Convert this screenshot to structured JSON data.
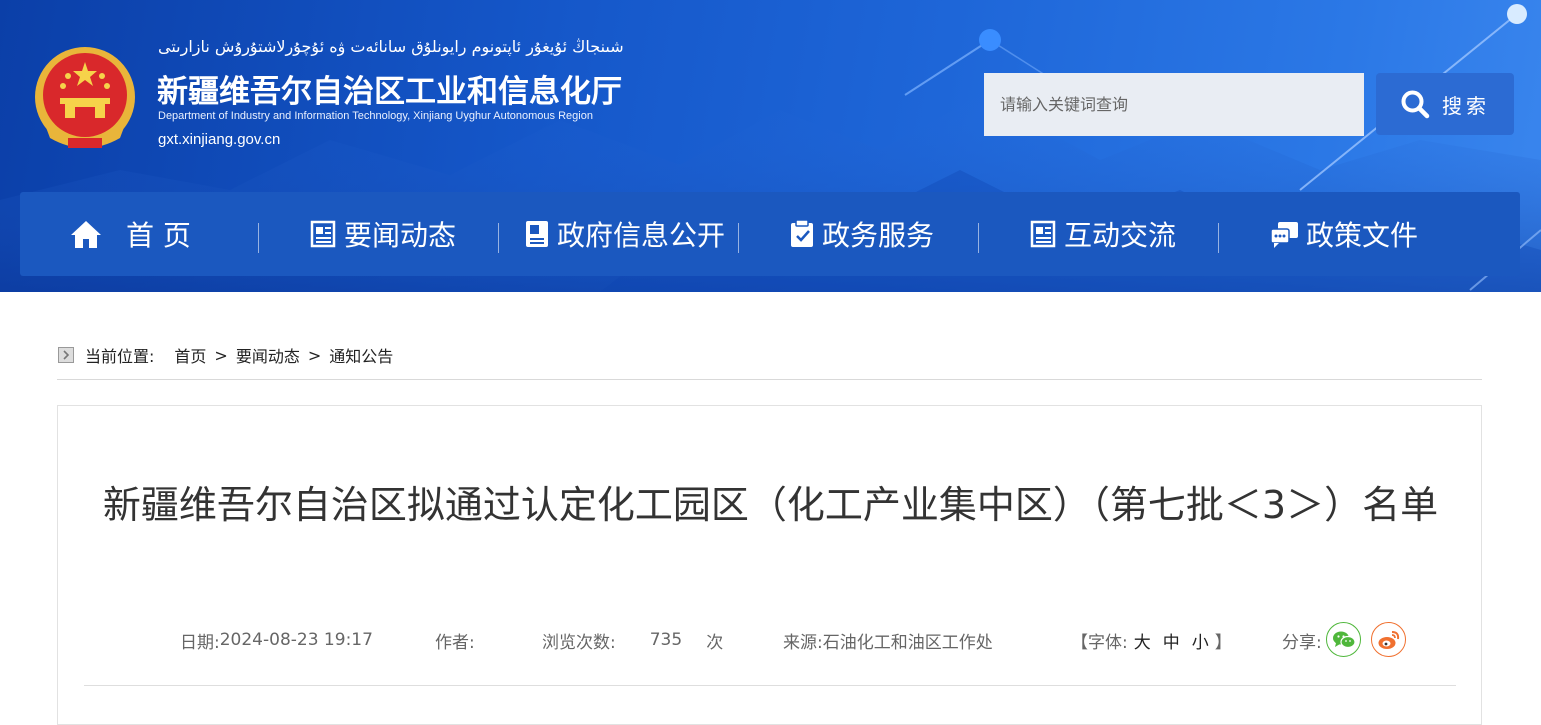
{
  "header": {
    "site_title_uyghur": "شىنجاڭ ئۇيغۇر ئاپتونوم رايونلۇق سانائەت ۋە ئۇچۇرلاشتۇرۇش نازارىتى",
    "site_title": "新疆维吾尔自治区工业和信息化厅",
    "site_title_en": "Department of Industry and Information Technology, Xinjiang Uyghur Autonomous Region",
    "site_url": "gxt.xinjiang.gov.cn",
    "emblem_icon": "national-emblem-icon"
  },
  "search": {
    "placeholder": "请输入关键词查询",
    "value": "",
    "button_label": "搜索"
  },
  "nav": {
    "items": [
      {
        "label": "首 页",
        "icon": "home-icon"
      },
      {
        "label": "要闻动态",
        "icon": "news-icon"
      },
      {
        "label": "政府信息公开",
        "icon": "document-icon"
      },
      {
        "label": "政务服务",
        "icon": "service-icon"
      },
      {
        "label": "互动交流",
        "icon": "interaction-icon"
      },
      {
        "label": "政策文件",
        "icon": "policy-icon"
      }
    ]
  },
  "breadcrumb": {
    "label": "当前位置:",
    "items": [
      "首页",
      "要闻动态",
      "通知公告"
    ],
    "separator": ">"
  },
  "article": {
    "title": "新疆维吾尔自治区拟通过认定化工园区（化工产业集中区）（第七批＜3＞）名单",
    "date_label": "日期:",
    "date": "2024-08-23 19:17",
    "author_label": "作者:",
    "author": "",
    "views_label": "浏览次数:",
    "views": "735",
    "views_unit": "次",
    "source_label": "来源:",
    "source": "石油化工和油区工作处",
    "font_label_open": "【字体:",
    "font_large": "大",
    "font_medium": "中",
    "font_small": "小",
    "font_label_close": "】",
    "share_label": "分享:",
    "share_icons": [
      "wechat-icon",
      "weibo-icon"
    ]
  },
  "colors": {
    "banner_blue": "#1557c9",
    "nav_blue": "#1b58bf",
    "wechat_green": "#4fb73b",
    "weibo_orange": "#f0702f"
  }
}
